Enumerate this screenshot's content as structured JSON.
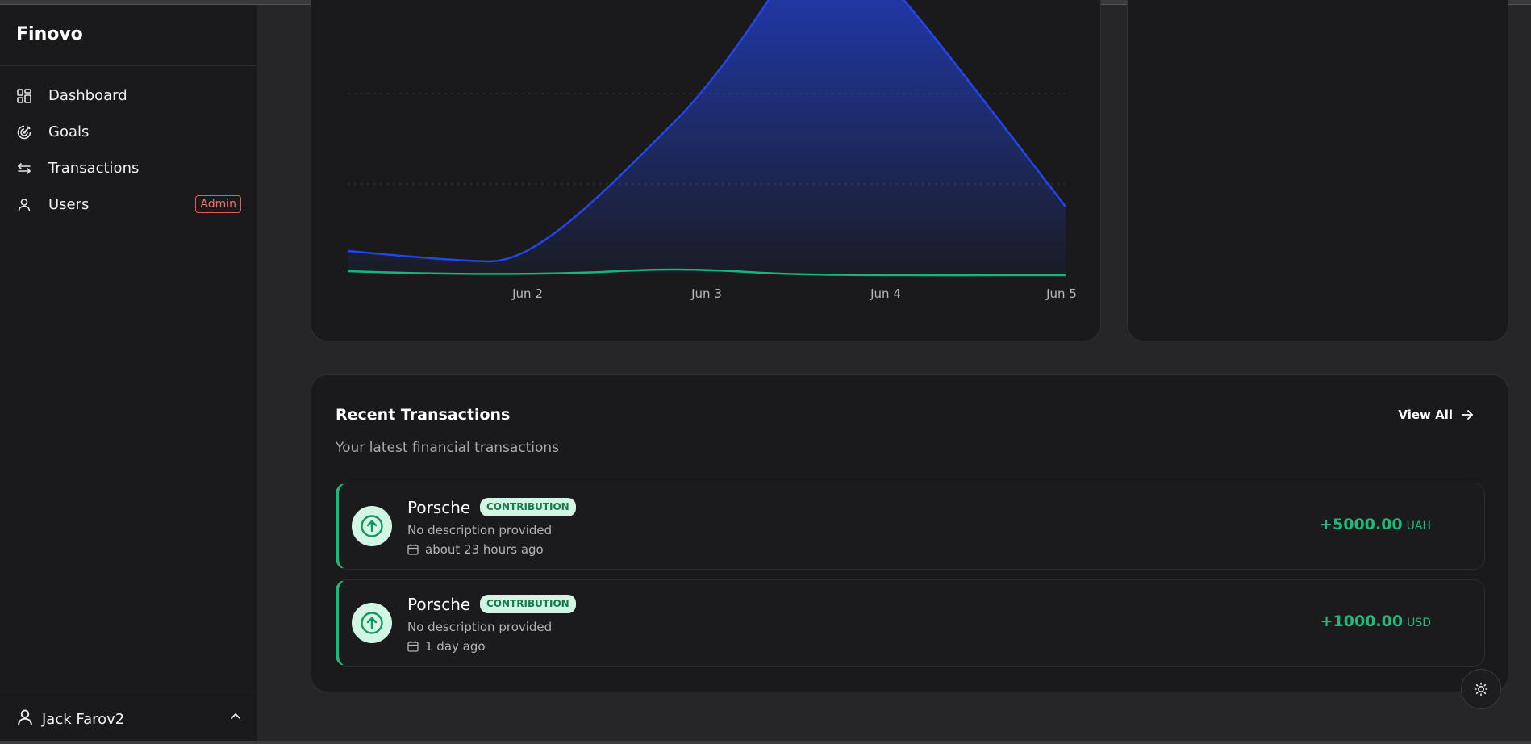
{
  "app": {
    "name": "Finovo"
  },
  "sidebar": {
    "items": [
      {
        "label": "Dashboard",
        "icon": "dashboard-icon"
      },
      {
        "label": "Goals",
        "icon": "target-icon"
      },
      {
        "label": "Transactions",
        "icon": "arrows-left-right-icon"
      },
      {
        "label": "Users",
        "icon": "user-icon",
        "badge": "Admin"
      }
    ],
    "user": {
      "name": "Jack Farov2",
      "icon": "user-icon"
    }
  },
  "chart_data": {
    "type": "area",
    "x_ticks": [
      "Jun 2",
      "Jun 3",
      "Jun 4",
      "Jun 5"
    ],
    "grid": true,
    "series": [
      {
        "color": "#2346e8",
        "fill": true
      },
      {
        "color": "#18b57a",
        "fill": false
      }
    ]
  },
  "transactions": {
    "title": "Recent Transactions",
    "subtitle": "Your latest financial transactions",
    "view_all": "View All",
    "items": [
      {
        "name": "Porsche",
        "type": "CONTRIBUTION",
        "description": "No description provided",
        "date": "about 23 hours ago",
        "amount": "+5000.00",
        "currency": "UAH"
      },
      {
        "name": "Porsche",
        "type": "CONTRIBUTION",
        "description": "No description provided",
        "date": "1 day ago",
        "amount": "+1000.00",
        "currency": "USD"
      }
    ]
  },
  "colors": {
    "accent_green": "#23b87a",
    "accent_blue": "#2346e8",
    "admin_red": "#e35c5c"
  }
}
